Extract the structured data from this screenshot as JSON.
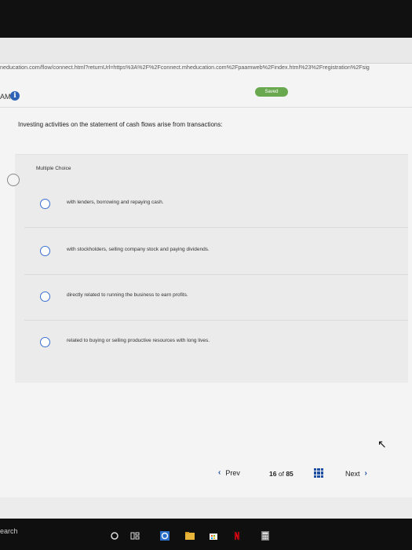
{
  "browser": {
    "url_fragment": "neducation.com/flow/connect.html?returnUrl=https%3A%2F%2Fconnect.mheducation.com%2Fpaamweb%2Findex.html%23%2Fregistration%2Fsig"
  },
  "header": {
    "time_fragment": "AM",
    "saved_label": "Saved"
  },
  "question": {
    "text": "Investing activities on the statement of cash flows arise from transactions:"
  },
  "multiple_choice": {
    "label": "Multiple Choice",
    "options": [
      {
        "text": "with lenders, borrowing and repaying cash."
      },
      {
        "text": "with stockholders, selling company stock and paying dividends."
      },
      {
        "text": "directly related to running the business to earn profits."
      },
      {
        "text": "related to buying or selling productive resources with long lives."
      }
    ]
  },
  "footer": {
    "prev_label": "Prev",
    "current_page": "16",
    "of_label": "of",
    "total_pages": "85",
    "next_label": "Next"
  },
  "taskbar": {
    "search_fragment": "earch"
  },
  "colors": {
    "accent": "#1f4fa3",
    "radio": "#3a6fd1",
    "saved": "#6aa84f",
    "info": "#2d62b5"
  }
}
